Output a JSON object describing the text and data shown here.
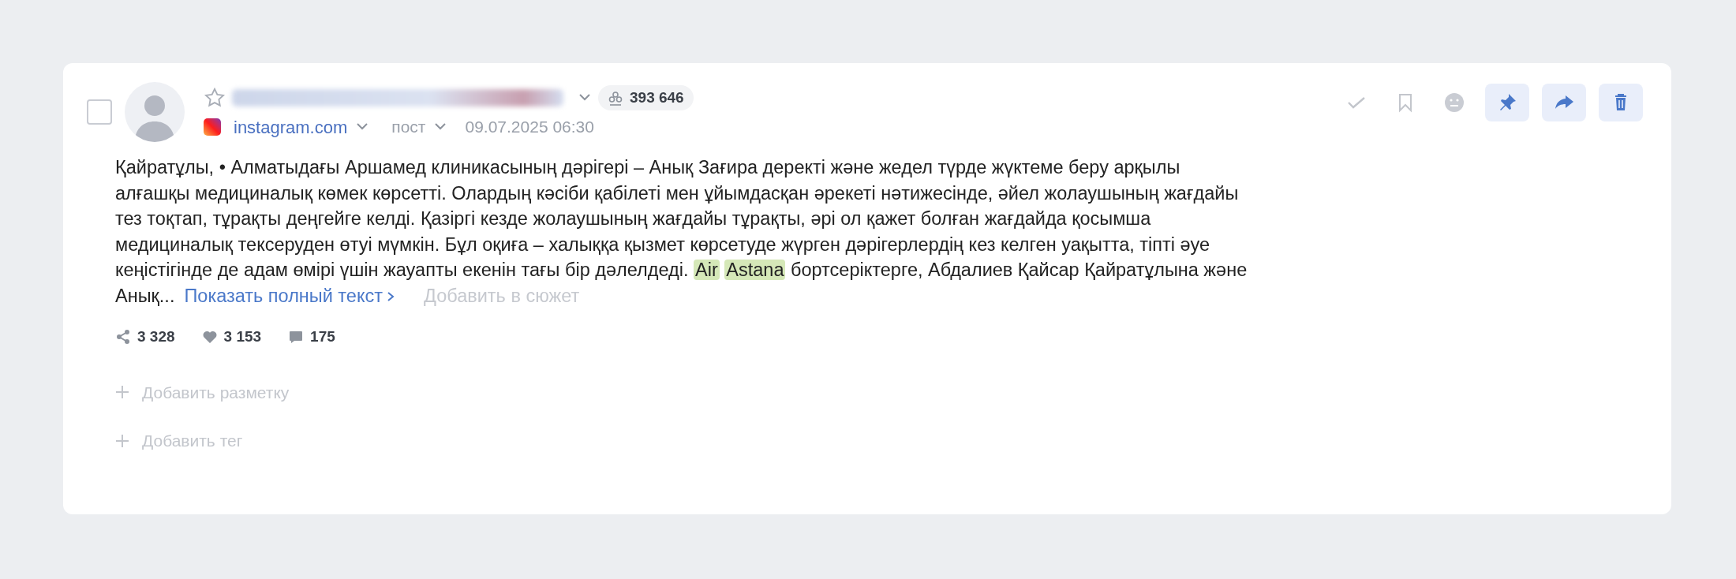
{
  "checkbox": {
    "checked": false
  },
  "post": {
    "starred": false,
    "audience": "393 646",
    "source": "instagram.com",
    "type": "пост",
    "datetime": "09.07.2025 06:30",
    "body": [
      {
        "text": "Қайратұлы, • Алматыдағы Аршамед клиникасының дәрігері – Анық Зағира деректі және жедел түрде жүктеме беру арқылы алғашқы медициналық көмек көрсетті. Олардың кәсіби қабілеті мен ұйымдасқан әрекеті нәтижесінде, әйел жолаушының жағдайы тез тоқтап, тұрақты деңгейге келді. Қазіргі кезде жолаушының жағдайы тұрақты, әрі ол қажет болған жағдайда қосымша медициналық тексеруден өтуі мүмкін. Бұл оқиға – халыққа қызмет көрсетуде жүрген дәрігерлердің кез келген уақытта, тіпті әуе кеңістігінде де адам өмірі үшін жауапты екенін тағы бір дәлелдеді.",
        "highlighted": false
      },
      {
        "text": "Air",
        "highlighted": true
      },
      {
        "text": "Astana",
        "highlighted": true
      },
      {
        "text": "бортсеріктерге, Абдалиев Қайсар Қайратұлына және Анық...",
        "highlighted": false
      }
    ],
    "show_more": "Показать полный текст",
    "add_to_story": "Добавить в сюжет",
    "stats": [
      {
        "kind": "shares",
        "value": "3 328"
      },
      {
        "kind": "likes",
        "value": "3 153"
      },
      {
        "kind": "comments",
        "value": "175"
      }
    ],
    "add_markup": "Добавить разметку",
    "add_tag": "Добавить тег"
  },
  "actions": [
    {
      "kind": "read"
    },
    {
      "kind": "bookmark"
    },
    {
      "kind": "sentiment"
    },
    {
      "kind": "pin"
    },
    {
      "kind": "forward"
    },
    {
      "kind": "delete"
    }
  ]
}
